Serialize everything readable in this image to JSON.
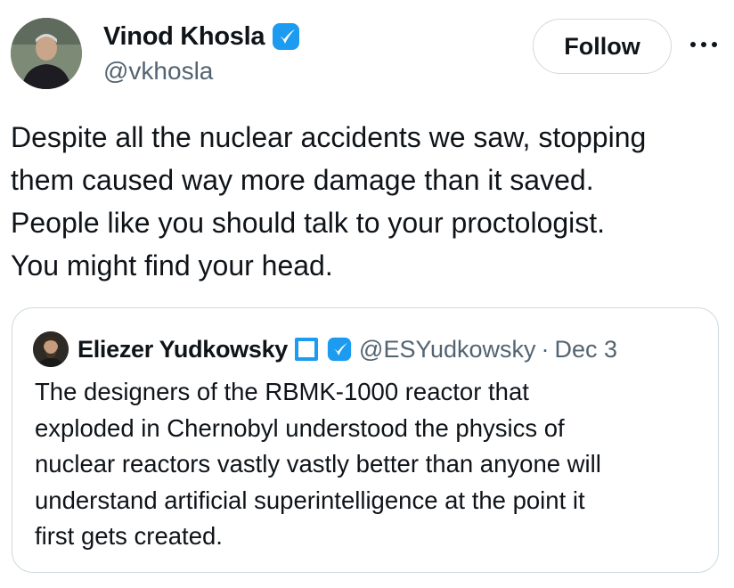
{
  "tweet": {
    "author": {
      "display_name": "Vinod Khosla",
      "handle": "@vkhosla",
      "avatar_icon": "person-avatar-icon",
      "verified_color": "#1d9bf0"
    },
    "follow_label": "Follow",
    "more_icon": "ellipsis-icon",
    "text_lines": [
      "Despite all the nuclear accidents we saw, stopping",
      "them caused way more damage than it saved.",
      "People like you should talk to your proctologist.",
      "You might find your head."
    ]
  },
  "quote": {
    "author": {
      "display_name": "Eliezer Yudkowsky",
      "handle": "@ESYudkowsky",
      "separator": "·",
      "date": "Dec 3",
      "avatar_icon": "person-avatar-icon"
    },
    "text_lines": [
      "The designers of the RBMK-1000 reactor that",
      "exploded in Chernobyl understood the physics of",
      "nuclear reactors vastly vastly better than anyone will",
      "understand artificial superintelligence at the point it",
      "first gets created."
    ]
  },
  "colors": {
    "text": "#0f1419",
    "secondary": "#536471",
    "accent": "#1d9bf0",
    "border": "#cfd9de"
  }
}
